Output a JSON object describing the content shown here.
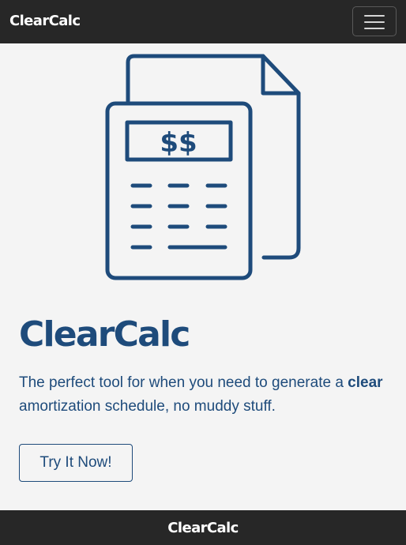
{
  "brand": {
    "name": "ClearCalc"
  },
  "navbar": {
    "menu_icon": "hamburger-menu-icon"
  },
  "hero": {
    "illustration_icon": "calculator-document-icon",
    "calculator_display": "$$",
    "title": "ClearCalc",
    "tagline_before": "The perfect tool for when you need to generate a",
    "tagline_emphasis": "clear",
    "tagline_after": "amortization schedule, no muddy stuff.",
    "cta_label": "Try It Now!"
  },
  "footer": {
    "brand": "ClearCalc"
  },
  "colors": {
    "navbar_bg": "#272727",
    "page_bg": "#f4f4f4",
    "accent": "#1e4b7b"
  }
}
